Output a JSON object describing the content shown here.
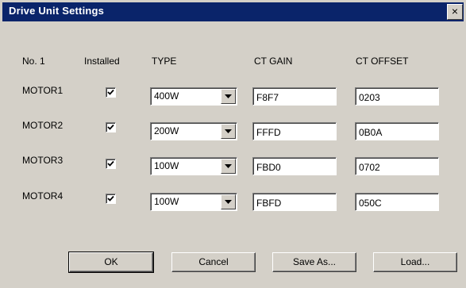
{
  "window": {
    "title": "Drive Unit Settings",
    "close_glyph": "×"
  },
  "headers": {
    "no": "No. 1",
    "installed": "Installed",
    "type": "TYPE",
    "ct_gain": "CT GAIN",
    "ct_offset": "CT OFFSET"
  },
  "rows": [
    {
      "name": "MOTOR1",
      "installed": true,
      "type": "400W",
      "ct_gain": "F8F7",
      "ct_offset": "0203"
    },
    {
      "name": "MOTOR2",
      "installed": true,
      "type": "200W",
      "ct_gain": "FFFD",
      "ct_offset": "0B0A"
    },
    {
      "name": "MOTOR3",
      "installed": true,
      "type": "100W",
      "ct_gain": "FBD0",
      "ct_offset": "0702"
    },
    {
      "name": "MOTOR4",
      "installed": true,
      "type": "100W",
      "ct_gain": "FBFD",
      "ct_offset": "050C"
    }
  ],
  "buttons": {
    "ok": "OK",
    "cancel": "Cancel",
    "save_as": "Save As...",
    "load": "Load..."
  },
  "colors": {
    "titlebar": "#0a246a",
    "face": "#d4d0c8"
  },
  "icons": {
    "close": "close-icon",
    "dropdown": "chevron-down-icon",
    "check": "checkmark-icon"
  }
}
